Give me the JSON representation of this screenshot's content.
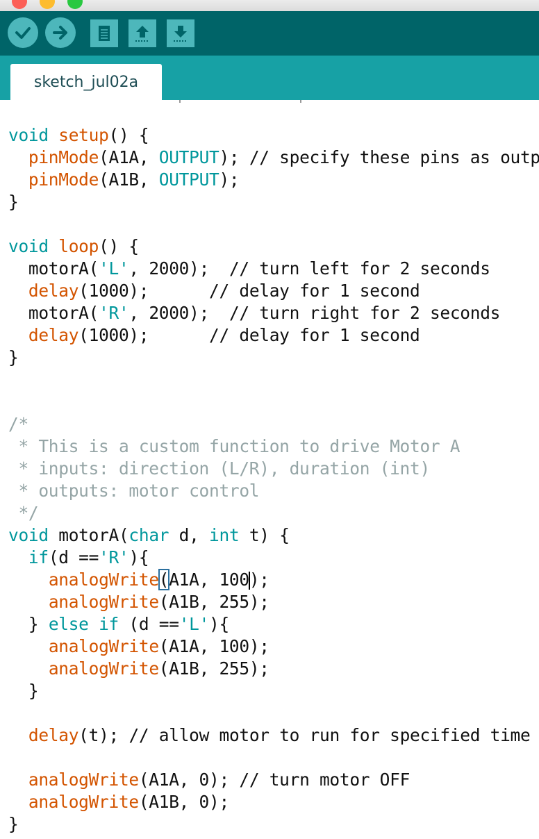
{
  "window": {
    "traffic_lights": [
      "close",
      "minimize",
      "zoom"
    ]
  },
  "toolbar": {
    "buttons": [
      {
        "name": "verify",
        "icon": "checkmark-icon"
      },
      {
        "name": "upload",
        "icon": "right-arrow-icon"
      },
      {
        "name": "new",
        "icon": "document-icon"
      },
      {
        "name": "open",
        "icon": "up-arrow-icon"
      },
      {
        "name": "save",
        "icon": "down-arrow-icon"
      }
    ],
    "colors": {
      "bar": "#006468",
      "button": "#4db7bb"
    }
  },
  "tabs": [
    {
      "label": "sketch_jul02a",
      "active": true
    }
  ],
  "editor": {
    "lines": {
      "l0": [
        "void",
        " ",
        "setup",
        "() {"
      ],
      "l1": [
        "  ",
        "pinMode",
        "(A1A, ",
        "OUTPUT",
        "); ",
        "// specify these pins as outputs"
      ],
      "l2": [
        "  ",
        "pinMode",
        "(A1B, ",
        "OUTPUT",
        ");"
      ],
      "l3": [
        "}"
      ],
      "l4": [
        ""
      ],
      "l5": [
        "void",
        " ",
        "loop",
        "() {"
      ],
      "l6": [
        "  motorA(",
        "'L'",
        ", 2000);  ",
        "// turn left for 2 seconds"
      ],
      "l7": [
        "  ",
        "delay",
        "(1000);      ",
        "// delay for 1 second"
      ],
      "l8": [
        "  motorA(",
        "'R'",
        ", 2000);  ",
        "// turn right for 2 seconds"
      ],
      "l9": [
        "  ",
        "delay",
        "(1000);      ",
        "// delay for 1 second"
      ],
      "l10": [
        "}"
      ],
      "l13": [
        "/*"
      ],
      "l14": [
        " * This is a custom function to drive Motor A"
      ],
      "l15": [
        " * inputs: direction (L/R), duration (int)"
      ],
      "l16": [
        " * outputs: motor control"
      ],
      "l17": [
        " */"
      ],
      "l18": [
        "void",
        " motorA(",
        "char",
        " d, ",
        "int",
        " t) {"
      ],
      "l19": [
        "  ",
        "if",
        "(d ==",
        "'R'",
        "){"
      ],
      "l20": [
        "    ",
        "analogWrite",
        "(",
        "A1A, 100",
        ");"
      ],
      "l21": [
        "    ",
        "analogWrite",
        "(A1B, 255);"
      ],
      "l22": [
        "  } ",
        "else",
        " ",
        "if",
        " (d ==",
        "'L'",
        "){"
      ],
      "l23": [
        "    ",
        "analogWrite",
        "(A1A, 100);"
      ],
      "l24": [
        "    ",
        "analogWrite",
        "(A1B, 255);"
      ],
      "l25": [
        "  }"
      ],
      "l27": [
        "  ",
        "delay",
        "(t); ",
        "// allow motor to run for specified time"
      ],
      "l29": [
        "  ",
        "analogWrite",
        "(A1A, 0); ",
        "// turn motor OFF"
      ],
      "l30": [
        "  ",
        "analogWrite",
        "(A1B, 0);"
      ],
      "l31": [
        "}"
      ]
    },
    "colors": {
      "keyword": "#00979c",
      "function": "#d35400",
      "comment": "#95a5a6",
      "text": "#111111"
    }
  }
}
